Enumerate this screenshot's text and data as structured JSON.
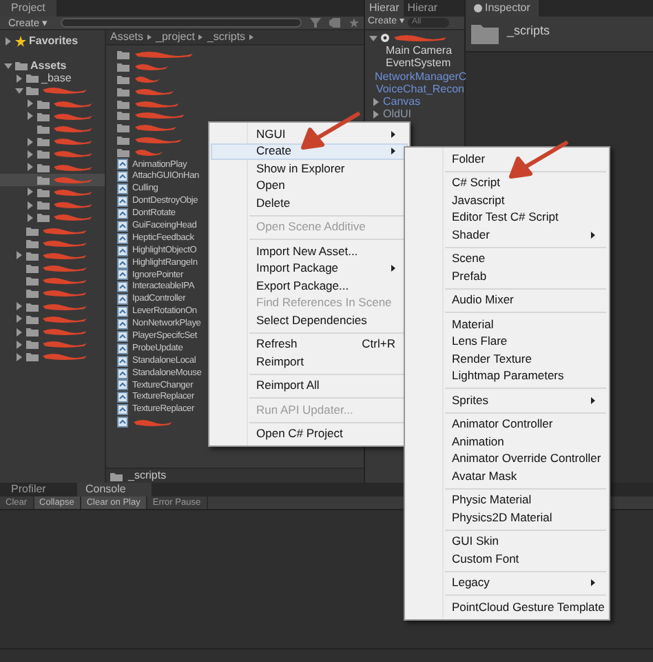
{
  "project": {
    "tab": "Project",
    "create": "Create ▾",
    "breadcrumb": [
      "Assets",
      "_project",
      "_scripts"
    ],
    "favorites": {
      "label": "Favorites",
      "expanded": false
    },
    "tree": [
      {
        "label": "Assets",
        "kind": "branch",
        "expanded": true,
        "selected": false,
        "children": [
          {
            "label": "_base",
            "kind": "branch",
            "expanded": false,
            "selected": false
          },
          {
            "kind": "branch",
            "redacted": true,
            "expanded": true,
            "selected": false,
            "children": [
              {
                "kind": "branch",
                "redacted": true,
                "expanded": false,
                "selected": false
              },
              {
                "kind": "branch",
                "redacted": true,
                "expanded": false,
                "selected": false
              },
              {
                "kind": "leaf",
                "redacted": true,
                "selected": false
              },
              {
                "kind": "branch",
                "redacted": true,
                "expanded": false,
                "selected": false
              },
              {
                "kind": "branch",
                "redacted": true,
                "expanded": false,
                "selected": false
              },
              {
                "kind": "branch",
                "redacted": true,
                "expanded": false,
                "selected": false
              },
              {
                "kind": "leaf",
                "redacted": true,
                "selected": true
              },
              {
                "kind": "branch",
                "redacted": true,
                "expanded": false,
                "selected": false
              },
              {
                "kind": "branch",
                "redacted": true,
                "expanded": false,
                "selected": false
              },
              {
                "kind": "branch",
                "redacted": true,
                "expanded": false,
                "selected": false
              }
            ]
          },
          {
            "kind": "leaf",
            "redacted": true,
            "selected": false
          },
          {
            "kind": "leaf",
            "redacted": true,
            "selected": false
          },
          {
            "kind": "branch",
            "redacted": true,
            "expanded": false,
            "selected": false
          },
          {
            "kind": "leaf",
            "redacted": true,
            "selected": false
          },
          {
            "kind": "leaf",
            "redacted": true,
            "selected": false
          },
          {
            "kind": "leaf",
            "redacted": true,
            "selected": false
          },
          {
            "kind": "branch",
            "redacted": true,
            "expanded": false,
            "selected": false
          },
          {
            "kind": "branch",
            "redacted": true,
            "expanded": false,
            "selected": false
          },
          {
            "kind": "branch",
            "redacted": true,
            "expanded": false,
            "selected": false
          },
          {
            "kind": "branch",
            "redacted": true,
            "expanded": false,
            "selected": false
          },
          {
            "kind": "branch",
            "redacted": true,
            "expanded": false,
            "selected": false
          }
        ]
      }
    ],
    "files": [
      {
        "kind": "folder",
        "redacted": true
      },
      {
        "kind": "folder",
        "redacted": true
      },
      {
        "kind": "folder",
        "redacted": true
      },
      {
        "kind": "folder",
        "redacted": true
      },
      {
        "kind": "folder",
        "redacted": true
      },
      {
        "kind": "folder",
        "redacted": true
      },
      {
        "kind": "folder",
        "redacted": true
      },
      {
        "kind": "folder",
        "redacted": true
      },
      {
        "kind": "folder",
        "redacted": true
      },
      {
        "kind": "script",
        "label": "AnimationPlay"
      },
      {
        "kind": "script",
        "label": "AttachGUIOnHan"
      },
      {
        "kind": "script",
        "label": "Culling"
      },
      {
        "kind": "script",
        "label": "DontDestroyObje"
      },
      {
        "kind": "script",
        "label": "DontRotate"
      },
      {
        "kind": "script",
        "label": "GuiFaceingHead"
      },
      {
        "kind": "script",
        "label": "HepticFeedback"
      },
      {
        "kind": "script",
        "label": "HighlightObjectO"
      },
      {
        "kind": "script",
        "label": "HighlightRangeIn"
      },
      {
        "kind": "script",
        "label": "IgnorePointer"
      },
      {
        "kind": "script",
        "label": "InteracteableIPA"
      },
      {
        "kind": "script",
        "label": "IpadController"
      },
      {
        "kind": "script",
        "label": "LeverRotationOn"
      },
      {
        "kind": "script",
        "label": "NonNetworkPlaye"
      },
      {
        "kind": "script",
        "label": "PlayerSpecifcSet"
      },
      {
        "kind": "script",
        "label": "ProbeUpdate"
      },
      {
        "kind": "script",
        "label": "StandaloneLocal"
      },
      {
        "kind": "script",
        "label": "StandaloneMouse"
      },
      {
        "kind": "script",
        "label": "TextureChanger"
      },
      {
        "kind": "script",
        "label": "TextureReplacer"
      },
      {
        "kind": "script",
        "label": "TextureReplacer"
      },
      {
        "kind": "script",
        "redacted": true
      }
    ],
    "path": "_scripts"
  },
  "hierarchy": {
    "tabs": [
      {
        "label": "Hierar",
        "selected": true
      },
      {
        "label": "Hierar",
        "selected": false
      }
    ],
    "create": "Create ▾",
    "search": {
      "placeholder": "All"
    },
    "items": [
      {
        "kind": "scene",
        "redacted": true,
        "expanded": true
      },
      {
        "kind": "object",
        "label": "Main Camera"
      },
      {
        "kind": "object",
        "label": "EventSystem"
      },
      {
        "kind": "prefab",
        "label": "NetworkManagerC"
      },
      {
        "kind": "prefab",
        "label": "VoiceChat_Recon"
      },
      {
        "kind": "prefab",
        "label": "Canvas",
        "expanded": false
      },
      {
        "kind": "prefab_inactive",
        "label": "OldUI",
        "expanded": false
      }
    ]
  },
  "inspector": {
    "tab": "Inspector",
    "title": "_scripts"
  },
  "console": {
    "tabs": [
      {
        "label": "Profiler",
        "selected": false
      },
      {
        "label": "Console",
        "selected": true
      }
    ],
    "buttons": [
      {
        "label": "Clear",
        "on": false
      },
      {
        "label": "Collapse",
        "on": true
      },
      {
        "label": "Clear on Play",
        "on": true
      },
      {
        "label": "Error Pause",
        "on": false
      }
    ]
  },
  "context_menu": [
    {
      "kind": "item",
      "label": "NGUI",
      "submenu": true,
      "disabled": false,
      "selected": false
    },
    {
      "kind": "item",
      "label": "Create",
      "submenu": true,
      "disabled": false,
      "selected": true
    },
    {
      "kind": "item",
      "label": "Show in Explorer",
      "disabled": false,
      "selected": false
    },
    {
      "kind": "item",
      "label": "Open",
      "disabled": false,
      "selected": false
    },
    {
      "kind": "item",
      "label": "Delete",
      "disabled": false,
      "selected": false
    },
    {
      "kind": "separator"
    },
    {
      "kind": "item",
      "label": "Open Scene Additive",
      "disabled": true,
      "selected": false
    },
    {
      "kind": "separator"
    },
    {
      "kind": "item",
      "label": "Import New Asset...",
      "disabled": false,
      "selected": false
    },
    {
      "kind": "item",
      "label": "Import Package",
      "submenu": true,
      "disabled": false,
      "selected": false
    },
    {
      "kind": "item",
      "label": "Export Package...",
      "disabled": false,
      "selected": false
    },
    {
      "kind": "item",
      "label": "Find References In Scene",
      "disabled": true,
      "selected": false
    },
    {
      "kind": "item",
      "label": "Select Dependencies",
      "disabled": false,
      "selected": false
    },
    {
      "kind": "separator"
    },
    {
      "kind": "item",
      "label": "Refresh",
      "shortcut": "Ctrl+R",
      "disabled": false,
      "selected": false
    },
    {
      "kind": "item",
      "label": "Reimport",
      "disabled": false,
      "selected": false
    },
    {
      "kind": "separator"
    },
    {
      "kind": "item",
      "label": "Reimport All",
      "disabled": false,
      "selected": false
    },
    {
      "kind": "separator"
    },
    {
      "kind": "item",
      "label": "Run API Updater...",
      "disabled": true,
      "selected": false
    },
    {
      "kind": "separator"
    },
    {
      "kind": "item",
      "label": "Open C# Project",
      "disabled": false,
      "selected": false
    }
  ],
  "create_submenu": [
    {
      "kind": "item",
      "label": "Folder"
    },
    {
      "kind": "separator"
    },
    {
      "kind": "item",
      "label": "C# Script"
    },
    {
      "kind": "item",
      "label": "Javascript"
    },
    {
      "kind": "item",
      "label": "Editor Test C# Script"
    },
    {
      "kind": "item",
      "label": "Shader",
      "submenu": true
    },
    {
      "kind": "separator"
    },
    {
      "kind": "item",
      "label": "Scene"
    },
    {
      "kind": "item",
      "label": "Prefab"
    },
    {
      "kind": "separator"
    },
    {
      "kind": "item",
      "label": "Audio Mixer"
    },
    {
      "kind": "separator"
    },
    {
      "kind": "item",
      "label": "Material"
    },
    {
      "kind": "item",
      "label": "Lens Flare"
    },
    {
      "kind": "item",
      "label": "Render Texture"
    },
    {
      "kind": "item",
      "label": "Lightmap Parameters"
    },
    {
      "kind": "separator"
    },
    {
      "kind": "item",
      "label": "Sprites",
      "submenu": true
    },
    {
      "kind": "separator"
    },
    {
      "kind": "item",
      "label": "Animator Controller"
    },
    {
      "kind": "item",
      "label": "Animation"
    },
    {
      "kind": "item",
      "label": "Animator Override Controller"
    },
    {
      "kind": "item",
      "label": "Avatar Mask"
    },
    {
      "kind": "separator"
    },
    {
      "kind": "item",
      "label": "Physic Material"
    },
    {
      "kind": "item",
      "label": "Physics2D Material"
    },
    {
      "kind": "separator"
    },
    {
      "kind": "item",
      "label": "GUI Skin"
    },
    {
      "kind": "item",
      "label": "Custom Font"
    },
    {
      "kind": "separator"
    },
    {
      "kind": "item",
      "label": "Legacy",
      "submenu": true
    },
    {
      "kind": "separator"
    },
    {
      "kind": "item",
      "label": "PointCloud Gesture Template"
    }
  ]
}
